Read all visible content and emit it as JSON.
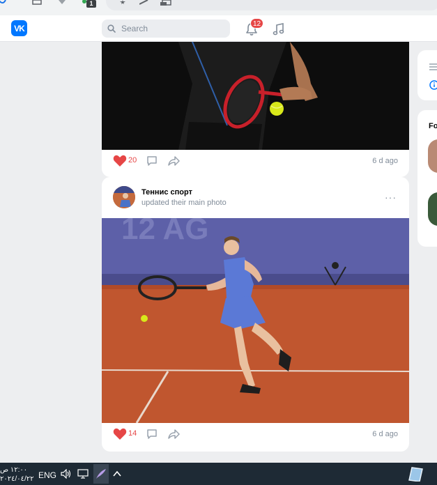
{
  "browser": {
    "extension_badge": "1"
  },
  "header": {
    "logo": "VK",
    "search": {
      "placeholder": "Search"
    },
    "notifications_count": "12"
  },
  "posts": [
    {
      "likes": "20",
      "time": "6 d ago"
    },
    {
      "author": "Теннис спорт",
      "subtitle": "updated their main photo",
      "more": "···",
      "likes": "14",
      "time": "6 d ago"
    }
  ],
  "sidebar": {
    "heading_partial": "Fo"
  },
  "taskbar": {
    "time": "١٢:٠٠ ص",
    "date": "٢٠٢٤/٠٤/٢٢",
    "language": "ENG"
  },
  "colors": {
    "accent": "#0077ff",
    "like": "#e64646",
    "secondary_text": "#818c99"
  }
}
